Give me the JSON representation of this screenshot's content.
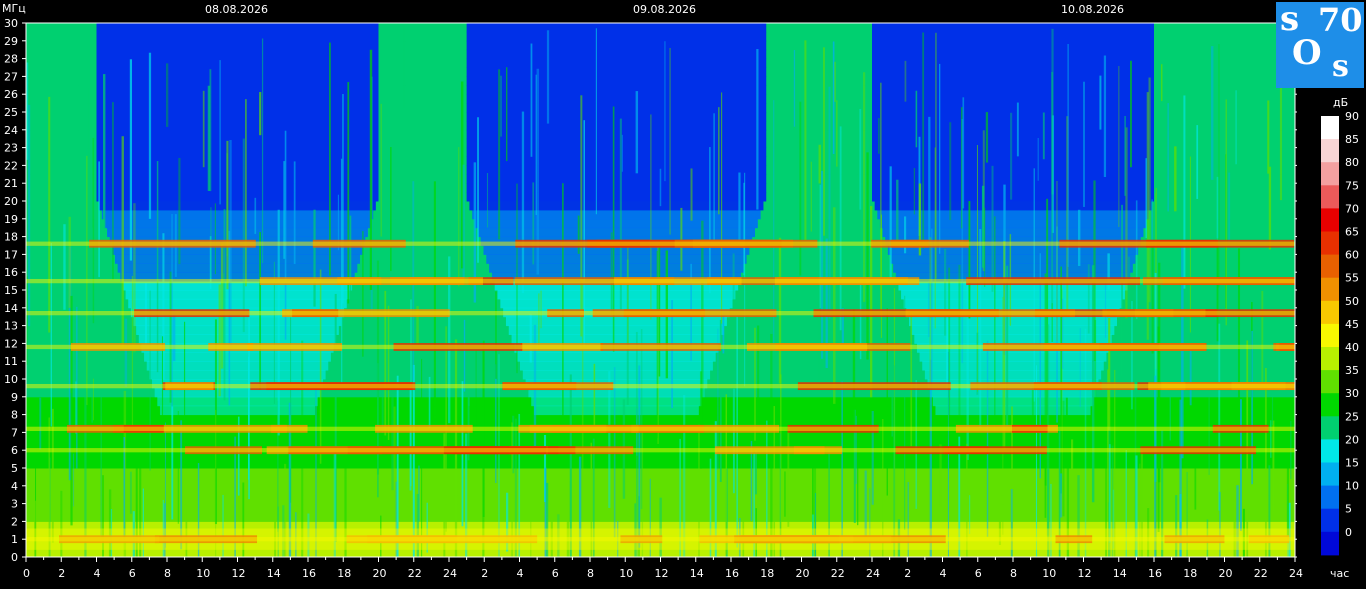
{
  "chart_data": {
    "type": "heatmap",
    "ylabel": "МГц",
    "xlabel": "час",
    "colorbar_label": "дБ",
    "dates": [
      "08.08.2026",
      "09.08.2026",
      "10.08.2026"
    ],
    "y_ticks": [
      0,
      1,
      2,
      3,
      4,
      5,
      6,
      7,
      8,
      9,
      10,
      11,
      12,
      13,
      14,
      15,
      16,
      17,
      18,
      19,
      20,
      21,
      22,
      23,
      24,
      25,
      26,
      27,
      28,
      29,
      30
    ],
    "ylim": [
      0,
      30
    ],
    "x_tick_labels": [
      "0",
      "2",
      "4",
      "6",
      "8",
      "10",
      "12",
      "14",
      "16",
      "18",
      "20",
      "22",
      "24",
      "2",
      "4",
      "6",
      "8",
      "10",
      "12",
      "14",
      "16",
      "18",
      "20",
      "22",
      "24",
      "2",
      "4",
      "6",
      "8",
      "10",
      "12",
      "14",
      "16",
      "18",
      "20",
      "22",
      "24"
    ],
    "x_tick_hours": [
      0,
      2,
      4,
      6,
      8,
      10,
      12,
      14,
      16,
      18,
      20,
      22,
      24,
      26,
      28,
      30,
      32,
      34,
      36,
      38,
      40,
      42,
      44,
      46,
      48,
      50,
      52,
      54,
      56,
      58,
      60,
      62,
      64,
      66,
      68,
      70,
      72
    ],
    "xlim_hours": [
      0,
      72
    ],
    "colorbar_ticks": [
      90,
      85,
      80,
      75,
      70,
      65,
      60,
      55,
      50,
      45,
      40,
      35,
      30,
      25,
      20,
      15,
      10,
      5,
      0
    ],
    "colorbar_colors": [
      "#ffffff",
      "#f8d4d4",
      "#f4a0a0",
      "#ec5a5a",
      "#e80000",
      "#e83000",
      "#e86000",
      "#f09000",
      "#f8c800",
      "#f8f800",
      "#b8f000",
      "#60e000",
      "#00d800",
      "#00d070",
      "#00e8e8",
      "#00b0f0",
      "#0070f0",
      "#0030e8",
      "#0008d8"
    ],
    "red_bands_mhz": [
      1.0,
      6.0,
      7.2,
      9.6,
      11.8,
      13.7,
      15.5,
      17.6
    ],
    "day_segments": [
      {
        "hours": [
          0,
          4
        ],
        "level": "high"
      },
      {
        "hours": [
          4,
          20
        ],
        "level": "low"
      },
      {
        "hours": [
          20,
          25
        ],
        "level": "high"
      },
      {
        "hours": [
          25,
          42
        ],
        "level": "low"
      },
      {
        "hours": [
          42,
          48
        ],
        "level": "high"
      },
      {
        "hours": [
          48,
          64
        ],
        "level": "low"
      },
      {
        "hours": [
          64,
          72
        ],
        "level": "high"
      }
    ]
  },
  "logo": {
    "t1": "s",
    "t2": "70",
    "t3": "O",
    "t4": "s"
  }
}
